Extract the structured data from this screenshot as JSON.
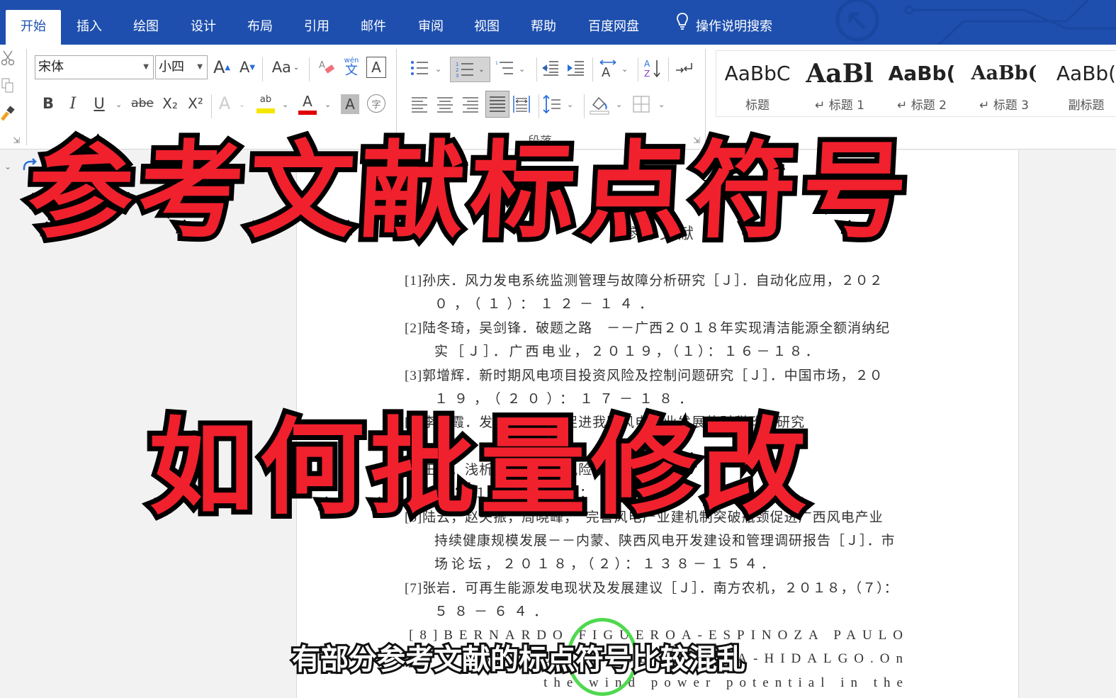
{
  "tabs": [
    {
      "label": "开始",
      "active": true
    },
    {
      "label": "插入"
    },
    {
      "label": "绘图"
    },
    {
      "label": "设计"
    },
    {
      "label": "布局"
    },
    {
      "label": "引用"
    },
    {
      "label": "邮件"
    },
    {
      "label": "审阅"
    },
    {
      "label": "视图"
    },
    {
      "label": "帮助"
    },
    {
      "label": "百度网盘"
    }
  ],
  "tell_me": {
    "icon": "lightbulb-icon",
    "label": "操作说明搜索"
  },
  "font": {
    "name": "宋体",
    "size": "小四",
    "grow": "A",
    "shrink": "A",
    "change_case": "Aa",
    "bold": "B",
    "italic": "I",
    "underline": "U",
    "strikethrough": "abe",
    "subscript": "X₂",
    "superscript": "X²",
    "text_effects": "A",
    "highlight": "ab",
    "font_color": "A",
    "char_shading": "A",
    "enclose": "字",
    "phonetic": "wén",
    "phonetic_char": "文",
    "char_border": "A",
    "highlight_color": "#f5e600",
    "font_color_value": "#e00000"
  },
  "paragraph": {
    "group_label": "段落"
  },
  "styles": [
    {
      "preview": "AaBbC",
      "name": "标题"
    },
    {
      "preview": "AaBl",
      "name": "↵ 标题 1"
    },
    {
      "preview": "AaBb(",
      "name": "↵ 标题 2"
    },
    {
      "preview": "AaBb(",
      "name": "↵ 标题 3"
    },
    {
      "preview": "AaBb(",
      "name": "副标题"
    }
  ],
  "document": {
    "title": "参考文献",
    "references": [
      {
        "first": "[1]孙庆．风力发电系统监测管理与故障分析研究［Ｊ］．自动化应用，２０２",
        "cont": "０，（１）：１２－１４．"
      },
      {
        "first": "[2]陆冬琦，吴剑锋．破题之路　－－广西２０１８年实现清洁能源全额消纳纪",
        "cont": "实［Ｊ］．广西电业，２０１９，（１）：１６－１８．"
      },
      {
        "first": "[3]郭增辉．新时期风电项目投资风险及控制问题研究［Ｊ］．中国市场，２０",
        "cont": "１９，（２０）：１７－１８．"
      },
      {
        "first": "[4]李晓霞．发挥财政作用促进我国风电产业发展的财税政策研究",
        "cont": ""
      },
      {
        "first": "[5]王磊．浅析风电项目在风险管理中的控制",
        "cont": "２０１９，（２）：１２－１４．"
      },
      {
        "first": "[6]陆云，赵夫振，周晓峰，　完善风电产业建机制突破瓶颈促进广西风电产业",
        "cont": "持续健康规模发展－－内蒙、陕西风电开发建设和管理调研报告［Ｊ］．市",
        "cont2": "场论坛，２０１８，（２）：１３８－１５４．"
      },
      {
        "first": "[7]张岩．可再生能源发电现状及发展建议［Ｊ］．南方农机，２０１８，（７）：",
        "cont": "５８－６４．"
      }
    ],
    "reference_8": [
      "[8]BERNARDO FIGUEROA-ESPINOZA PAULO",
      "SALLES JORGE ZAVALA-HIDALGO.On",
      "the wind power potential in the"
    ]
  },
  "overlay": {
    "title_line1": "参考文献标点符号",
    "title_line2": "如何批量修改",
    "subtitle": "有部分参考文献的标点符号比较混乱"
  }
}
